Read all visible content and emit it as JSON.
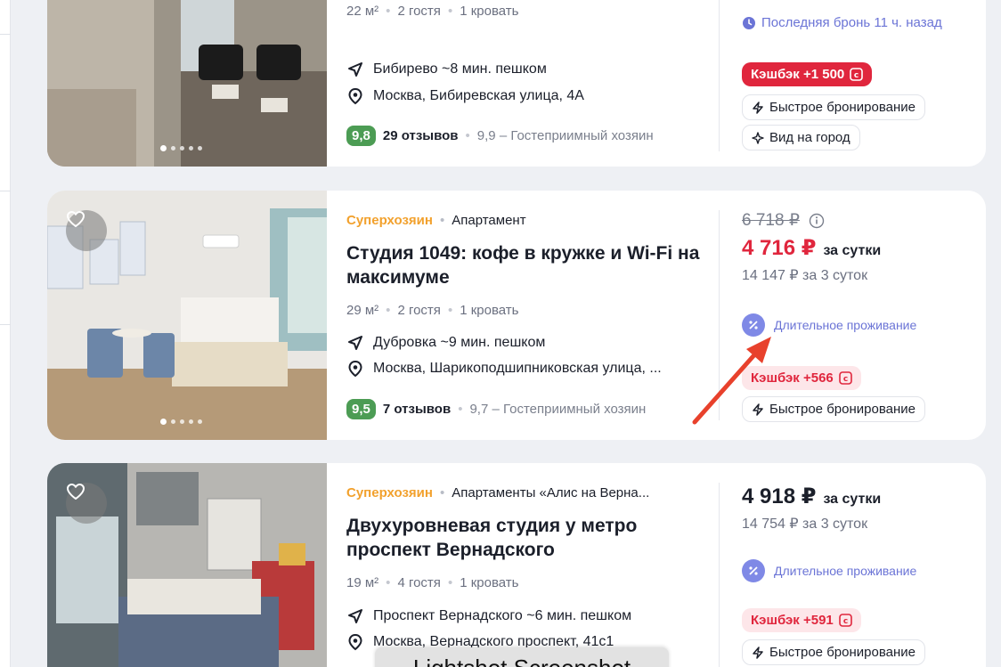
{
  "listings": [
    {
      "meta": {
        "area": "22 м²",
        "guests": "2 гостя",
        "beds": "1 кровать"
      },
      "metro": "Бибирево ~8 мин. пешком",
      "address": "Москва, Бибиревская улица, 4А",
      "rating": "9,8",
      "reviews": "29 отзывов",
      "host_score": "9,9 – Гостеприимный хозяин",
      "recent_booking": "Последняя бронь 11 ч. назад",
      "cashback": "Кэшбэк +1 500",
      "chips": [
        "Быстрое бронирование",
        "Вид на город"
      ]
    },
    {
      "host_badge": "Суперхозяин",
      "type": "Апартамент",
      "title": "Студия 1049: кофе в кружке и Wi-Fi на максимуме",
      "meta": {
        "area": "29 м²",
        "guests": "2 гостя",
        "beds": "1 кровать"
      },
      "metro": "Дубровка ~9 мин. пешком",
      "address": "Москва, Шарикоподшипниковская улица, ...",
      "rating": "9,5",
      "reviews": "7 отзывов",
      "host_score": "9,7 – Гостеприимный хозяин",
      "old_price": "6 718 ₽",
      "price": "4 716 ₽",
      "per_night": "за сутки",
      "total": "14 147 ₽ за 3 суток",
      "long_stay": "Длительное проживание",
      "cashback": "Кэшбэк +566",
      "chips": [
        "Быстрое бронирование"
      ]
    },
    {
      "host_badge": "Суперхозяин",
      "type": "Апартаменты «Алис на Верна...",
      "title": "Двухуровневая студия у метро проспект Вернадского",
      "meta": {
        "area": "19 м²",
        "guests": "4 гостя",
        "beds": "1 кровать"
      },
      "metro": "Проспект Вернадского ~6 мин. пешком",
      "address": "Москва, Вернадского проспект, 41с1",
      "price": "4 918 ₽",
      "per_night": "за сутки",
      "total": "14 754 ₽ за 3 суток",
      "long_stay": "Длительное проживание",
      "cashback": "Кэшбэк +591",
      "chips": [
        "Быстрое бронирование"
      ]
    }
  ],
  "watermark": "Lightshot Screenshot",
  "colors": {
    "accent_red": "#e0263d",
    "superhost": "#f2a12d",
    "rating_green": "#4c9c54",
    "info_blue": "#6b74d6",
    "arrow": "#e8412c"
  }
}
